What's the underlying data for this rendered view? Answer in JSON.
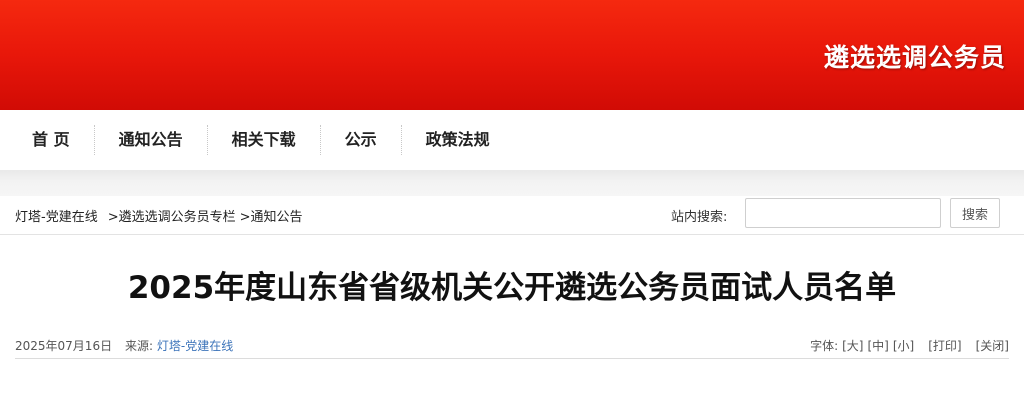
{
  "banner": {
    "title": "遴选选调公务员"
  },
  "nav": {
    "items": [
      "首 页",
      "通知公告",
      "相关下载",
      "公示",
      "政策法规"
    ]
  },
  "breadcrumb": {
    "home": "灯塔-党建在线",
    "section": ">遴选选调公务员专栏",
    "current": ">通知公告"
  },
  "search": {
    "label": "站内搜索:",
    "placeholder": "",
    "button": "搜索"
  },
  "article": {
    "title": "2025年度山东省省级机关公开遴选公务员面试人员名单",
    "date": "2025年07月16日",
    "source_label": "来源:",
    "source_name": "灯塔-党建在线",
    "font_label": "字体:",
    "font_large": "[大]",
    "font_medium": "[中]",
    "font_small": "[小]",
    "print": "[打印]",
    "close": "[关闭]"
  },
  "colors": {
    "banner_red": "#e8170a",
    "link_blue": "#3b73b9"
  }
}
